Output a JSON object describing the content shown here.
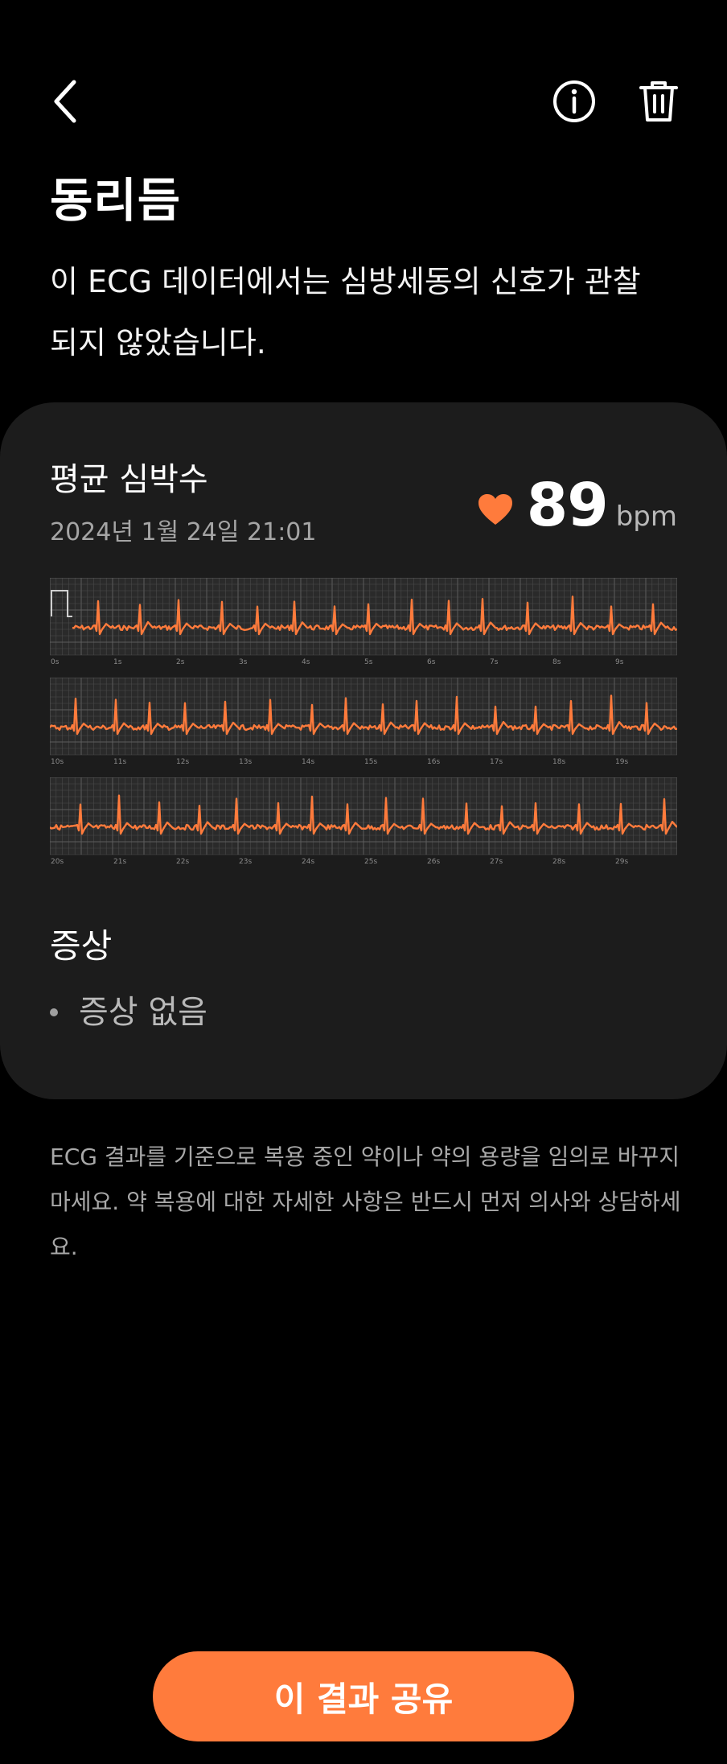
{
  "header": {
    "back_icon": "chevron-left-icon",
    "info_icon": "info-circle-icon",
    "delete_icon": "trash-icon"
  },
  "result": {
    "title": "동리듬",
    "description": "이 ECG 데이터에서는 심방세동의 신호가 관찰되지 않았습니다."
  },
  "heart_rate": {
    "label": "평균 심박수",
    "date": "2024년 1월 24일 21:01",
    "value": "89",
    "unit": "bpm",
    "icon": "heart-icon",
    "color": "#ff7b3c"
  },
  "ecg": {
    "line_color": "#ff7b3c",
    "grid_color": "#4a4a4a",
    "strips": [
      {
        "ticks": [
          "0s",
          "1s",
          "2s",
          "3s",
          "4s",
          "5s",
          "6s",
          "7s",
          "8s",
          "9s"
        ]
      },
      {
        "ticks": [
          "10s",
          "11s",
          "12s",
          "13s",
          "14s",
          "15s",
          "16s",
          "17s",
          "18s",
          "19s"
        ]
      },
      {
        "ticks": [
          "20s",
          "21s",
          "22s",
          "23s",
          "24s",
          "25s",
          "26s",
          "27s",
          "28s",
          "29s"
        ]
      }
    ]
  },
  "symptoms": {
    "title": "증상",
    "items": [
      "증상 없음"
    ]
  },
  "disclaimer": "ECG 결과를 기준으로 복용 중인 약이나 약의 용량을 임의로 바꾸지 마세요. 약 복용에 대한 자세한 사항은 반드시 먼저 의사와 상담하세요.",
  "share_button": {
    "label": "이 결과 공유",
    "color": "#ff7b3c"
  }
}
